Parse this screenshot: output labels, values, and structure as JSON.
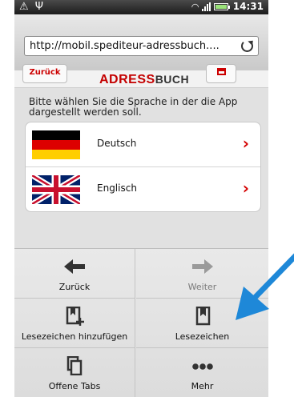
{
  "status_bar": {
    "time": "14:31",
    "icons": [
      "warning-icon",
      "usb-icon",
      "wifi-icon",
      "signal-icon",
      "battery-icon"
    ]
  },
  "browser": {
    "url": "http://mobil.spediteur-adressbuch....",
    "reload_icon": "reload-icon"
  },
  "page": {
    "back_label": "Zurück",
    "brand_part1": "ADRESS",
    "brand_part2": "BUCH",
    "intro": "Bitte wählen Sie die Sprache in der die App dargestellt werden soll.",
    "languages": [
      {
        "label": "Deutsch",
        "flag": "german-flag-icon"
      },
      {
        "label": "Englisch",
        "flag": "uk-flag-icon"
      }
    ]
  },
  "menu": {
    "items": [
      {
        "label": "Zurück",
        "icon": "arrow-left-icon",
        "enabled": true
      },
      {
        "label": "Weiter",
        "icon": "arrow-right-icon",
        "enabled": false
      },
      {
        "label": "Lesezeichen hinzufügen",
        "icon": "bookmark-add-icon",
        "enabled": true
      },
      {
        "label": "Lesezeichen",
        "icon": "bookmark-icon",
        "enabled": true
      },
      {
        "label": "Offene Tabs",
        "icon": "tabs-icon",
        "enabled": true
      },
      {
        "label": "Mehr",
        "icon": "more-icon",
        "enabled": true
      }
    ]
  },
  "colors": {
    "brand_red": "#c40000",
    "annotation_arrow": "#1e88d8"
  }
}
